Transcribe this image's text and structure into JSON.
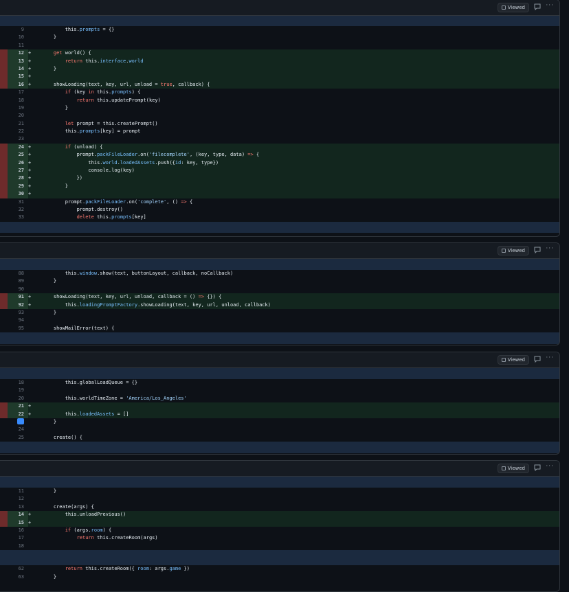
{
  "viewed_label": "Viewed",
  "more_label": "···",
  "files": [
    {
      "lines": [
        {
          "n": "9",
          "add": false,
          "code": "        this.prompts = {}"
        },
        {
          "n": "10",
          "add": false,
          "code": "    }"
        },
        {
          "n": "11",
          "add": false,
          "code": ""
        },
        {
          "n": "12",
          "add": true,
          "code": "    get world() {"
        },
        {
          "n": "13",
          "add": true,
          "code": "        return this.interface.world"
        },
        {
          "n": "14",
          "add": true,
          "code": "    }"
        },
        {
          "n": "15",
          "add": true,
          "code": ""
        },
        {
          "n": "16",
          "add": true,
          "code": "    showLoading(text, key, url, unload = true, callback) {"
        },
        {
          "n": "17",
          "add": false,
          "code": "        if (key in this.prompts) {"
        },
        {
          "n": "18",
          "add": false,
          "code": "            return this.updatePrompt(key)"
        },
        {
          "n": "19",
          "add": false,
          "code": "        }"
        },
        {
          "n": "20",
          "add": false,
          "code": ""
        },
        {
          "n": "21",
          "add": false,
          "code": "        let prompt = this.createPrompt()"
        },
        {
          "n": "22",
          "add": false,
          "code": "        this.prompts[key] = prompt"
        },
        {
          "n": "23",
          "add": false,
          "code": ""
        },
        {
          "n": "24",
          "add": true,
          "code": "        if (unload) {"
        },
        {
          "n": "25",
          "add": true,
          "code": "            prompt.packFileLoader.on('filecomplete', (key, type, data) => {"
        },
        {
          "n": "26",
          "add": true,
          "code": "                this.world.loadedAssets.push({id: key, type})"
        },
        {
          "n": "27",
          "add": true,
          "code": "                console.log(key)"
        },
        {
          "n": "28",
          "add": true,
          "code": "            })"
        },
        {
          "n": "29",
          "add": true,
          "code": "        }"
        },
        {
          "n": "30",
          "add": true,
          "code": ""
        },
        {
          "n": "31",
          "add": false,
          "code": "        prompt.packFileLoader.on('complete', () => {"
        },
        {
          "n": "32",
          "add": false,
          "code": "            prompt.destroy()"
        },
        {
          "n": "33",
          "add": false,
          "code": "            delete this.prompts[key]"
        }
      ]
    },
    {
      "lines": [
        {
          "n": "88",
          "add": false,
          "code": "        this.window.show(text, buttonLayout, callback, noCallback)"
        },
        {
          "n": "89",
          "add": false,
          "code": "    }"
        },
        {
          "n": "90",
          "add": false,
          "code": ""
        },
        {
          "n": "91",
          "add": true,
          "code": "    showLoading(text, key, url, unload, callback = () => {}) {"
        },
        {
          "n": "92",
          "add": true,
          "code": "        this.loadingPromptFactory.showLoading(text, key, url, unload, callback)"
        },
        {
          "n": "93",
          "add": false,
          "code": "    }"
        },
        {
          "n": "94",
          "add": false,
          "code": ""
        },
        {
          "n": "95",
          "add": false,
          "code": "    showMailError(text) {"
        }
      ]
    },
    {
      "lines": [
        {
          "n": "18",
          "add": false,
          "code": "        this.globalLoadQueue = {}"
        },
        {
          "n": "19",
          "add": false,
          "code": ""
        },
        {
          "n": "20",
          "add": false,
          "code": "        this.worldTimeZone = 'America/Los_Angeles'"
        },
        {
          "n": "21",
          "add": true,
          "code": ""
        },
        {
          "n": "22",
          "add": true,
          "code": "        this.loadedAssets = []"
        },
        {
          "n": "23",
          "add": false,
          "code": "    }",
          "comment": true
        },
        {
          "n": "24",
          "add": false,
          "code": ""
        },
        {
          "n": "25",
          "add": false,
          "code": "    create() {"
        }
      ]
    },
    {
      "lines_a": [
        {
          "n": "11",
          "add": false,
          "code": "    }"
        },
        {
          "n": "12",
          "add": false,
          "code": ""
        },
        {
          "n": "13",
          "add": false,
          "code": "    create(args) {"
        },
        {
          "n": "14",
          "add": true,
          "code": "        this.unloadPrevious()"
        },
        {
          "n": "15",
          "add": true,
          "code": ""
        },
        {
          "n": "16",
          "add": false,
          "code": "        if (args.room) {"
        },
        {
          "n": "17",
          "add": false,
          "code": "            return this.createRoom(args)"
        },
        {
          "n": "18",
          "add": false,
          "code": ""
        }
      ],
      "lines_b": [
        {
          "n": "62",
          "add": false,
          "code": "        return this.createRoom({ room: args.game })"
        },
        {
          "n": "63",
          "add": false,
          "code": "    }"
        }
      ]
    }
  ]
}
